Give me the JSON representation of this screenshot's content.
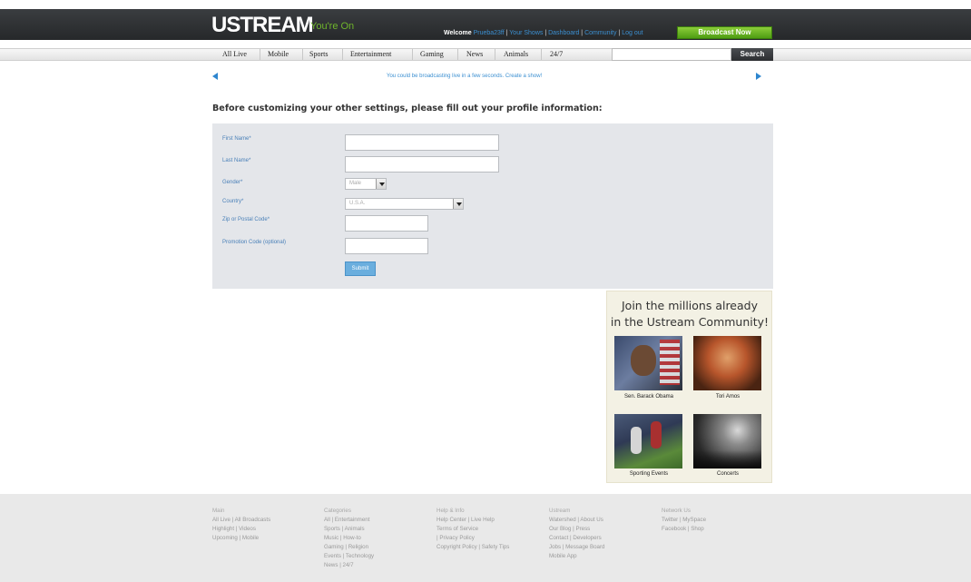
{
  "header": {
    "logo": "USTREAM",
    "tagline": "You're On",
    "welcome": "Welcome",
    "username": "Prueba23ff",
    "links": [
      "Your Shows",
      "Dashboard",
      "Community",
      "Log out"
    ],
    "broadcast_label": "Broadcast Now"
  },
  "nav": {
    "items": [
      "All Live",
      "Mobile",
      "Sports",
      "Entertainment",
      "Gaming",
      "News",
      "Animals",
      "24/7"
    ],
    "search_value": "",
    "search_label": "Search"
  },
  "promo": {
    "text": "You could be broadcasting live in a few seconds. Create a show!"
  },
  "main": {
    "heading": "Before customizing your other settings, please fill out your profile information:"
  },
  "form": {
    "first_name_label": "First Name*",
    "first_name_value": "",
    "last_name_label": "Last Name*",
    "last_name_value": "",
    "gender_label": "Gender*",
    "gender_value": "Male",
    "country_label": "Country*",
    "country_value": "U.S.A.",
    "zip_label": "Zip or Postal Code*",
    "zip_value": "",
    "promo_label": "Promotion Code (optional)",
    "promo_value": "",
    "submit_label": "Submit"
  },
  "community": {
    "line1": "Join the millions already",
    "line2": "in the Ustream Community!",
    "captions": [
      "Sen. Barack Obama",
      "Tori Amos",
      "Sporting Events",
      "Concerts"
    ]
  },
  "footer": {
    "columns": [
      {
        "title": "Main",
        "lines": [
          "All Live | All Broadcasts",
          "Highlight | Videos",
          "Upcoming | Mobile"
        ]
      },
      {
        "title": "Categories",
        "lines": [
          "All | Entertainment",
          "Sports | Animals",
          "Music | How-to",
          "Gaming | Religion",
          "Events | Technology",
          "News | 24/7"
        ]
      },
      {
        "title": "Help & Info",
        "lines": [
          "Help Center | Live Help",
          "Terms of Service",
          "| Privacy Policy",
          "Copyright Policy | Safety Tips"
        ]
      },
      {
        "title": "Ustream",
        "lines": [
          "Watershed | About Us",
          "Our Blog | Press",
          "Contact | Developers",
          "Jobs | Message Board",
          "Mobile App"
        ]
      },
      {
        "title": "Network Us",
        "lines": [
          "Twitter | MySpace",
          "Facebook | Shop"
        ]
      }
    ]
  }
}
